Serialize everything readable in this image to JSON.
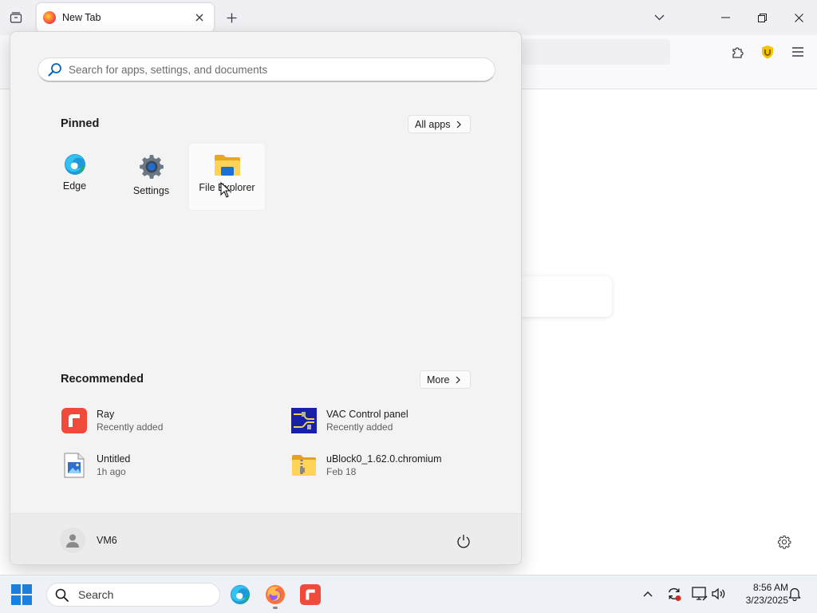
{
  "browser": {
    "tab": {
      "title": "New Tab",
      "icon": "firefox-icon"
    },
    "accent": "#ff7139"
  },
  "start_menu": {
    "search": {
      "placeholder": "Search for apps, settings, and documents"
    },
    "pinned": {
      "title": "Pinned",
      "all_apps_label": "All apps",
      "apps": [
        {
          "label": "Edge",
          "icon": "edge-icon"
        },
        {
          "label": "Settings",
          "icon": "settings-gear-icon"
        },
        {
          "label": "File Explorer",
          "icon": "file-explorer-icon"
        }
      ]
    },
    "recommended": {
      "title": "Recommended",
      "more_label": "More",
      "items": [
        {
          "name": "Ray",
          "sub": "Recently added",
          "icon": "ray-app-icon"
        },
        {
          "name": "VAC Control panel",
          "sub": "Recently added",
          "icon": "vac-control-panel-icon"
        },
        {
          "name": "Untitled",
          "sub": "1h ago",
          "icon": "image-file-icon"
        },
        {
          "name": "uBlock0_1.62.0.chromium",
          "sub": "Feb 18",
          "icon": "zip-folder-icon"
        }
      ]
    },
    "footer": {
      "user_name": "VM6"
    }
  },
  "taskbar": {
    "search_label": "Search",
    "time": "8:56 AM",
    "date": "3/23/2025"
  },
  "colors": {
    "start_accent": "#0067c0",
    "ray_red": "#f04a3a"
  }
}
